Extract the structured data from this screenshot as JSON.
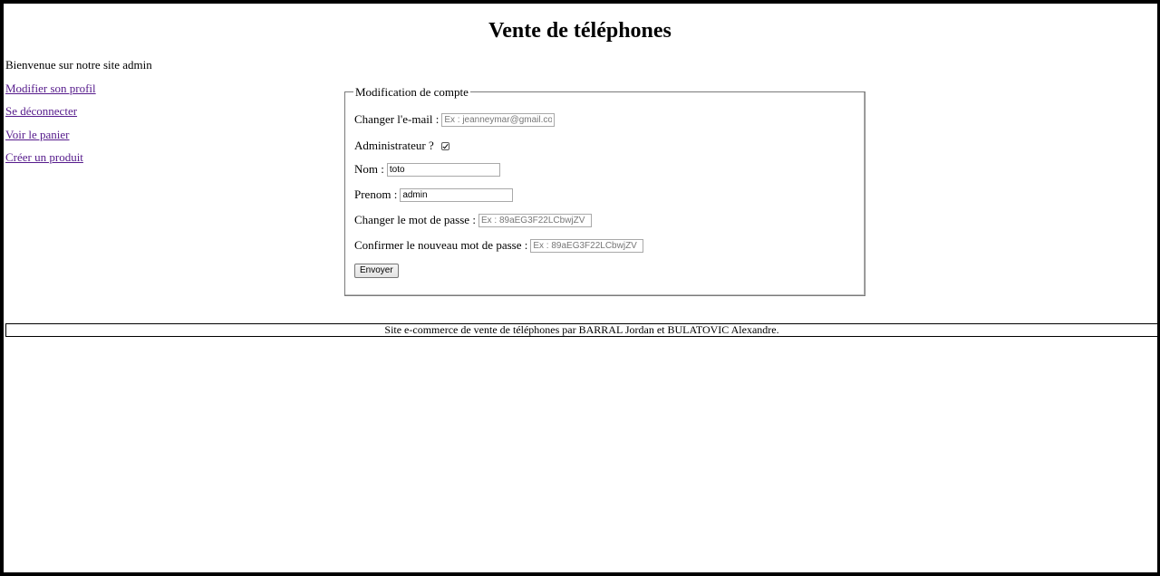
{
  "header": {
    "title": "Vente de téléphones"
  },
  "sidebar": {
    "welcome": "Bienvenue sur notre site admin",
    "links": [
      {
        "label": "Modifier son profil"
      },
      {
        "label": "Se déconnecter"
      },
      {
        "label": "Voir le panier"
      },
      {
        "label": "Créer un produit"
      }
    ]
  },
  "form": {
    "legend": "Modification de compte",
    "email": {
      "label": "Changer l'e-mail :",
      "value": "",
      "placeholder": "Ex : jeanneymar@gmail.com"
    },
    "admin": {
      "label": "Administrateur ?",
      "checked": true
    },
    "nom": {
      "label": "Nom :",
      "value": "toto"
    },
    "prenom": {
      "label": "Prenom :",
      "value": "admin"
    },
    "password": {
      "label": "Changer le mot de passe :",
      "placeholder": "Ex : 89aEG3F22LCbwjZV"
    },
    "confirm": {
      "label": "Confirmer le nouveau mot de passe :",
      "placeholder": "Ex : 89aEG3F22LCbwjZV"
    },
    "submit_label": "Envoyer"
  },
  "footer": {
    "text": "Site e-commerce de vente de téléphones par BARRAL Jordan et BULATOVIC Alexandre."
  }
}
